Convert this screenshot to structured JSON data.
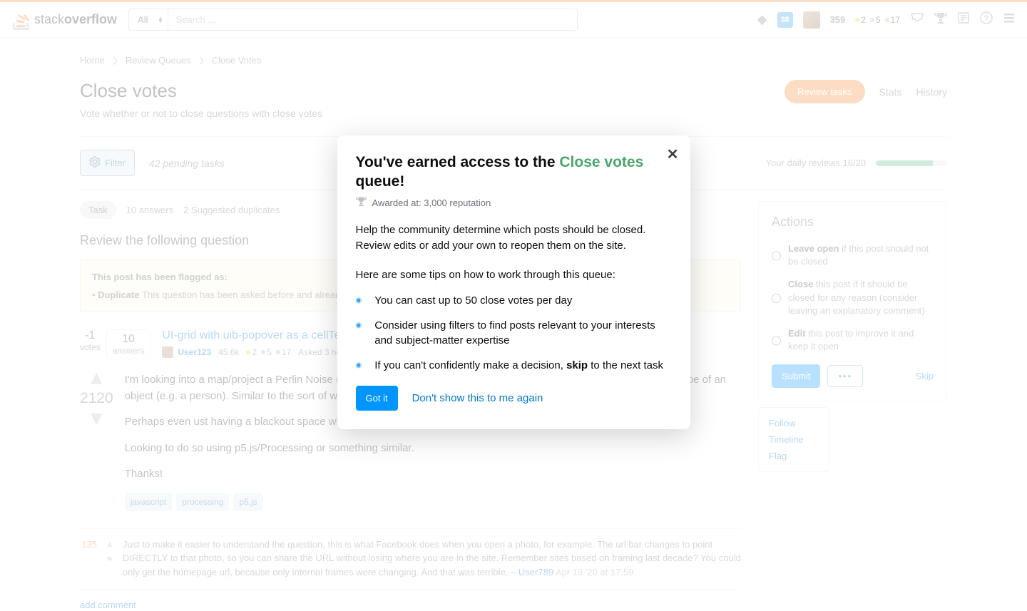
{
  "topbar": {
    "logo_text_light": "stack",
    "logo_text_bold": "overflow",
    "scope": "All",
    "search_placeholder": "Search ...",
    "badge_number": "38",
    "rep": "359",
    "gold": "2",
    "silver": "5",
    "bronze": "17"
  },
  "crumbs": {
    "home": "Home",
    "queues": "Review Queues",
    "current": "Close Votes"
  },
  "page": {
    "title": "Close votes",
    "subtitle": "Vote whether or not to close questions with close votes",
    "tab_review": "Review tasks",
    "tab_stats": "Stats",
    "tab_history": "History"
  },
  "toolbar": {
    "filter": "Filter",
    "pending": "42 pending tasks",
    "daily": "Your daily reviews 16/20"
  },
  "pills": {
    "task": "Task",
    "answers": "10 answers",
    "dupes": "2 Suggested duplicates"
  },
  "review_heading": "Review the following question",
  "flag": {
    "title": "This post has been flagged as:",
    "bullet_label": "Duplicate",
    "bullet_text": "This question has been asked before and already has an answer."
  },
  "question": {
    "score": "-1",
    "score_label": "votes",
    "answers": "10",
    "answers_label": "answers",
    "title": "UI-grid with uib-popover as a cellTemplate",
    "user": "User123",
    "rep": "45.6k",
    "gold": "2",
    "silver": "5",
    "bronze": "17",
    "asked": "Asked 3 hours ago"
  },
  "post": {
    "vote": "2120",
    "p1": "I'm looking into a map/project a Perlin Noise (or any other image for that matter, not just nonsense noise) forms the shape of an object (e.g. a person). Similar to the sort of way water would fill a glass, can I similarly reshape it?",
    "p2": "Perhaps even ust having a blackout space where the Perlin Noise replaced by a black filled svg.",
    "p3": "Looking to do so using p5.js/Processing or something similar.",
    "p4": "Thanks!",
    "tags": [
      "javascript",
      "processing",
      "p5.js"
    ]
  },
  "comment": {
    "score": "135",
    "text": "Just to make it easier to understand the question, this is what Facebook does when you open a photo, for example. The url bar changes to point DIRECTLY to that photo, so you can share the URL without losing where you are in the site. Remember sites based on framing last decade? You could only get the homepage url, because only internal frames were changing. And that was terrible. –",
    "user": "User789",
    "time": "Apr 19 '20 at 17:59",
    "add": "add comment"
  },
  "actions": {
    "title": "Actions",
    "leave_label": "Leave open",
    "leave_text": "if this post should not be closed",
    "close_label": "Close",
    "close_text": "this post if it should be closed for any reason (consider leaving an explanatory comment)",
    "edit_label": "Edit",
    "edit_text": "this post to improve it and keep it open",
    "submit": "Submit",
    "more": "•••",
    "skip": "Skip",
    "menu": {
      "follow": "Follow",
      "timeline": "Timeline",
      "flag": "Flag"
    }
  },
  "modal": {
    "title_pre": "You've earned access to the ",
    "title_green": "Close votes",
    "title_post": " queue!",
    "awarded": "Awarded at: 3,000 reputation",
    "p1": "Help the community determine which posts should be closed. Review edits or add your own to reopen them on the site.",
    "p2": "Here are some tips on how to work through this queue:",
    "tip1": "You can cast up to 50 close votes per day",
    "tip2": "Consider using filters to find posts relevant to your interests and subject-matter expertise",
    "tip3_pre": "If you can't confidently make a decision, ",
    "tip3_bold": "skip",
    "tip3_post": " to the next task",
    "got_it": "Got it",
    "dont_show": "Don't show this to me again"
  }
}
